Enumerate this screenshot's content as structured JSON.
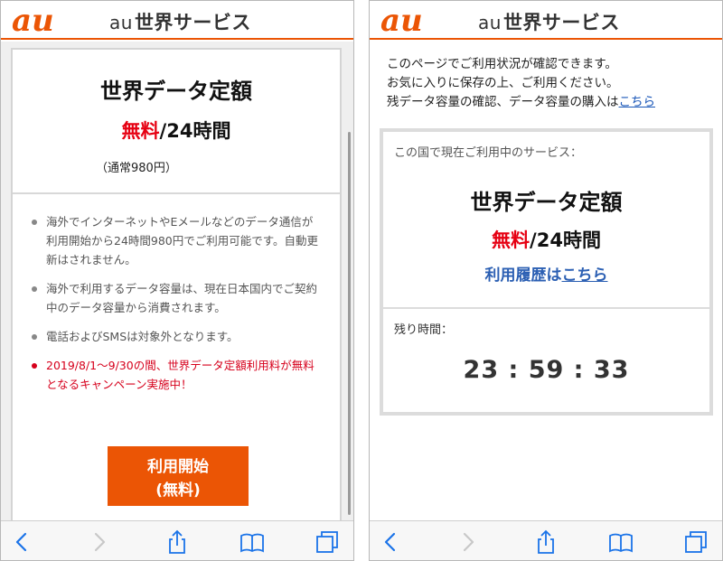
{
  "app": {
    "brand": "au",
    "title_suffix": "世界サービス",
    "brand_color": "#eb5505"
  },
  "left": {
    "plan_title": "世界データ定額",
    "price_free": "無料",
    "price_rest": "/24時間",
    "normal_price": "（通常980円）",
    "notes": [
      {
        "text": "海外でインターネットやEメールなどのデータ通信が利用開始から24時間980円でご利用可能です。自動更新はされません。",
        "highlight": false
      },
      {
        "text": "海外で利用するデータ容量は、現在日本国内でご契約中のデータ容量から消費されます。",
        "highlight": false
      },
      {
        "text": "電話およびSMSは対象外となります。",
        "highlight": false
      },
      {
        "text": "2019/8/1〜9/30の間、世界データ定額利用料が無料となるキャンペーン実施中！",
        "highlight": true
      }
    ],
    "start_button": {
      "line1": "利用開始",
      "line2": "(無料)"
    }
  },
  "right": {
    "intro_lines": [
      "このページでご利用状況が確認できます。",
      "お気に入りに保存の上、ご利用ください。"
    ],
    "intro_line3_prefix": "残データ容量の確認、データ容量の購入は",
    "intro_link": "こちら",
    "service_label": "この国で現在ご利用中のサービス：",
    "plan_title": "世界データ定額",
    "price_free": "無料",
    "price_rest": "/24時間",
    "history_prefix": "利用履歴は",
    "history_link": "こちら",
    "remaining_label": "残り時間：",
    "timer": "23 : 59 : 33"
  },
  "toolbar": {
    "icons": [
      "back-icon",
      "forward-icon",
      "share-icon",
      "bookmarks-icon",
      "tabs-icon"
    ]
  },
  "colors": {
    "accent_orange": "#eb5505",
    "free_red": "#e60012",
    "link_blue": "#1a57b8"
  }
}
